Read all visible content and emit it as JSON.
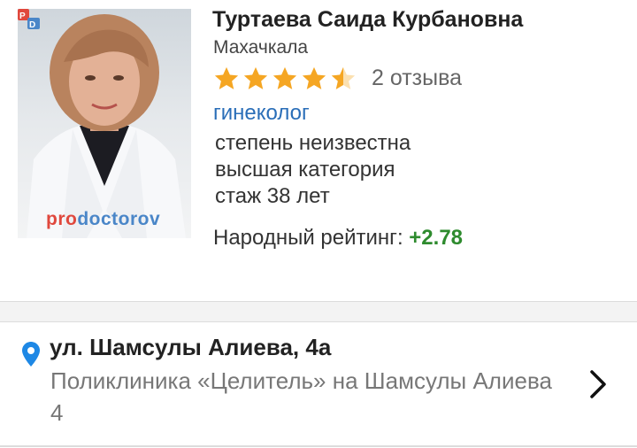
{
  "doctor": {
    "name": "Туртаева Саида Курбановна",
    "city": "Махачкала",
    "rating_stars": 4.5,
    "reviews": "2 отзыва",
    "specialty": "гинеколог",
    "degree": "степень неизвестна",
    "category": "высшая категория",
    "experience": "стаж 38 лет",
    "people_rating_label": "Народный рейтинг:",
    "people_rating_value": "+2.78"
  },
  "photo": {
    "watermark_pro": "pro",
    "watermark_doc": "doctorov"
  },
  "location": {
    "street": "ул. Шамсулы Алиева, 4а",
    "clinic": "Поликлиника «Целитель» на Шамсулы Алиева 4"
  },
  "colors": {
    "star": "#f5a623",
    "link": "#2a6eb8",
    "positive": "#2e8b2e",
    "pin": "#1e88e5"
  }
}
